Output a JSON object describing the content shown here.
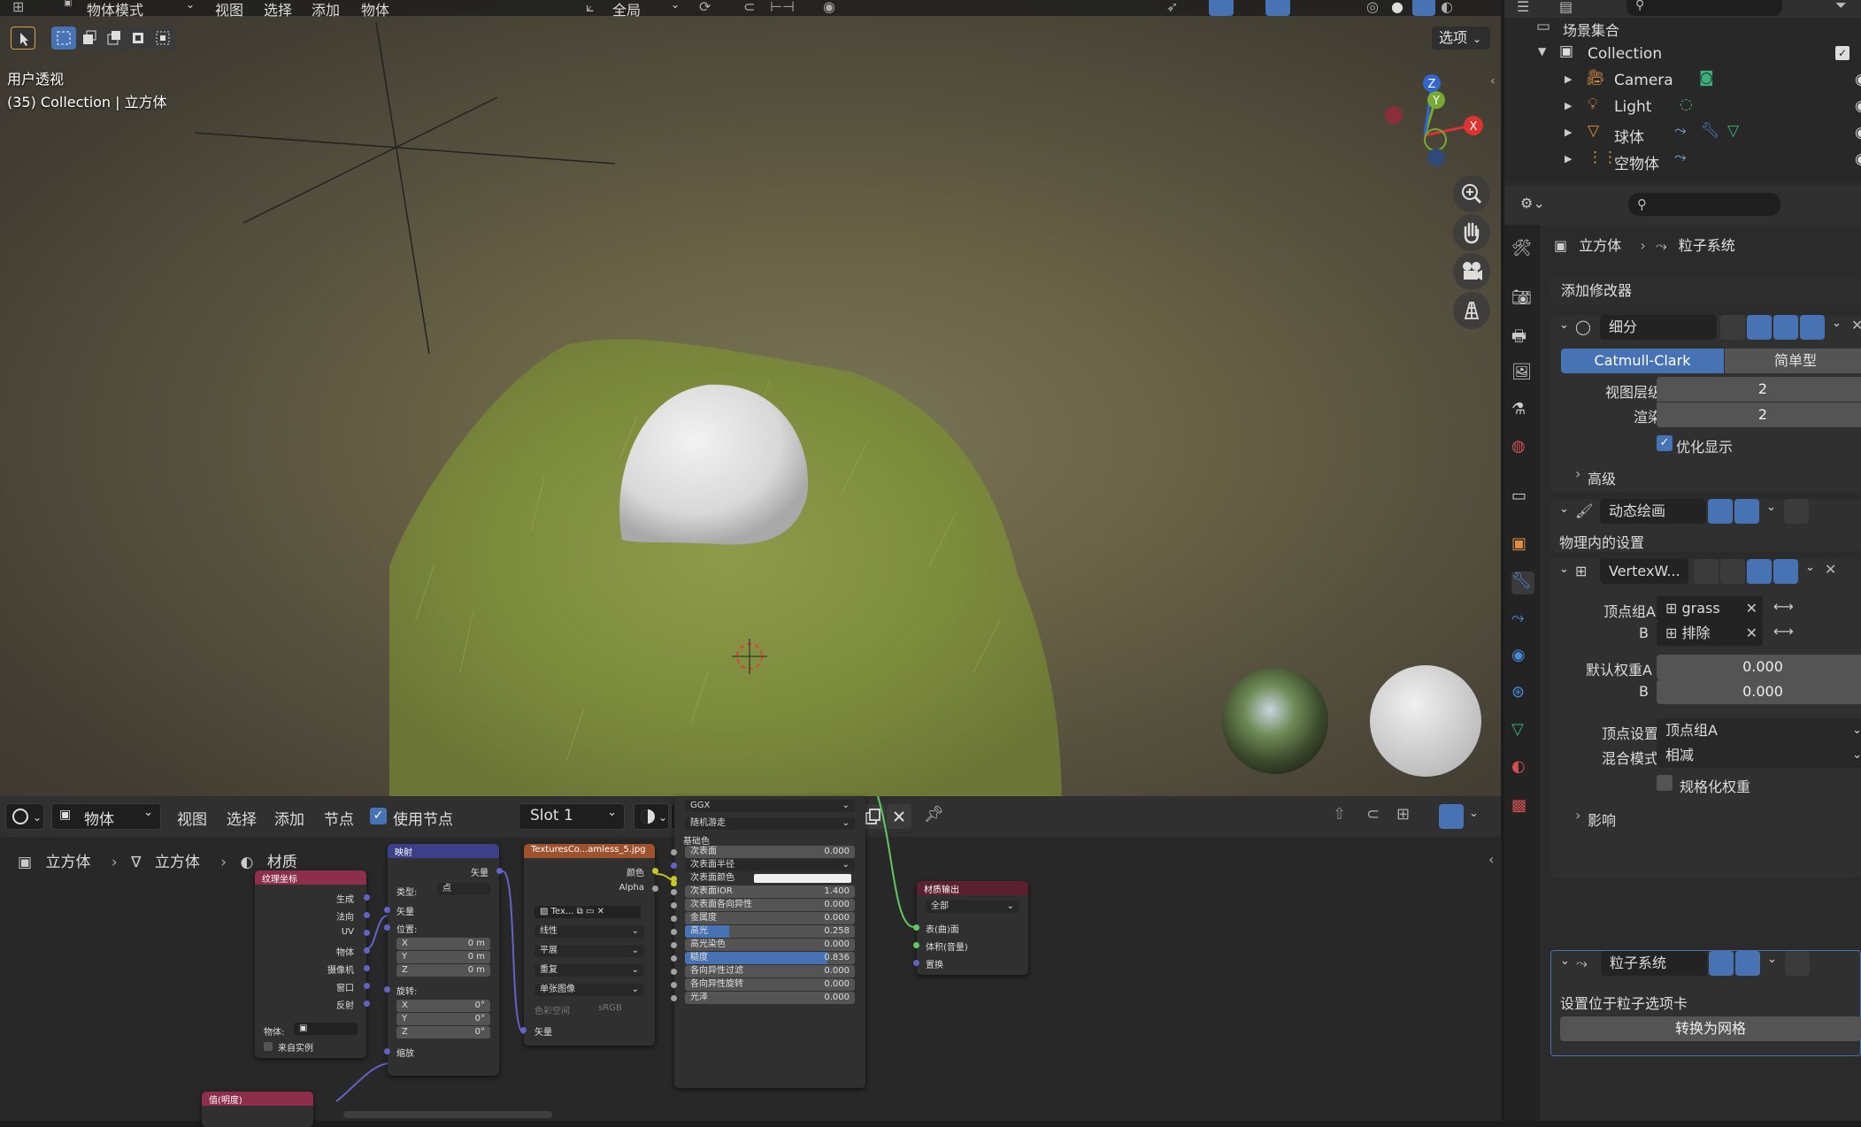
{
  "viewport": {
    "header": {
      "mode": "物体模式",
      "view": "视图",
      "select": "选择",
      "add": "添加",
      "object": "物体",
      "transform": "全局",
      "options": "选项"
    },
    "overlay_title": "用户透视",
    "overlay_sub": "(35) Collection | 立方体",
    "gizmo": {
      "x": "X",
      "y": "Y",
      "z": "Z"
    }
  },
  "node_editor": {
    "header": {
      "editor": "物体",
      "view": "视图",
      "select": "选择",
      "add": "添加",
      "node": "节点",
      "use_nodes": "使用节点",
      "slot": "Slot 1",
      "material": "材质"
    },
    "breadcrumb": [
      "立方体",
      "立方体",
      "材质"
    ],
    "nodes": {
      "texcoord": {
        "title": "纹理坐标",
        "outputs": [
          "生成",
          "法向",
          "UV",
          "物体",
          "摄像机",
          "窗口",
          "反射"
        ],
        "object_label": "物体:",
        "from_instancer": "来自实例"
      },
      "mapping": {
        "title": "映射",
        "output": "矢量",
        "type_label": "类型:",
        "type_value": "点",
        "input_vector": "矢量",
        "loc_label": "位置:",
        "loc": [
          "X",
          "0 m",
          "Y",
          "0 m",
          "Z",
          "0 m"
        ],
        "rot_label": "旋转:",
        "rot": [
          "X",
          "0°",
          "Y",
          "0°",
          "Z",
          "0°"
        ],
        "scale": "缩放"
      },
      "image": {
        "title": "TexturesCo...amless_5.jpg",
        "out_color": "颜色",
        "out_alpha": "Alpha",
        "img_name": "Tex...",
        "interp": "线性",
        "proj": "平展",
        "ext": "重复",
        "source": "单张图像",
        "colorspace_label": "色彩空间",
        "colorspace": "sRGB",
        "in_vector": "矢量"
      },
      "bsdf": {
        "dist": "GGX",
        "ss": "随机游走",
        "base_color": "基础色",
        "rows": [
          {
            "label": "次表面",
            "value": "0.000"
          },
          {
            "label": "次表面半径",
            "value": ""
          },
          {
            "label": "次表面颜色",
            "value": ""
          },
          {
            "label": "次表面IOR",
            "value": "1.400"
          },
          {
            "label": "次表面各向异性",
            "value": "0.000"
          },
          {
            "label": "金属度",
            "value": "0.000"
          },
          {
            "label": "高光",
            "value": "0.258"
          },
          {
            "label": "高光染色",
            "value": "0.000"
          },
          {
            "label": "糙度",
            "value": "0.836"
          },
          {
            "label": "各向异性过滤",
            "value": "0.000"
          },
          {
            "label": "各向异性旋转",
            "value": "0.000"
          },
          {
            "label": "光泽",
            "value": "0.000"
          }
        ],
        "specular_fill": 0.258,
        "roughness_fill": 0.836
      },
      "output": {
        "title": "材质输出",
        "target": "全部",
        "rows": [
          "表(曲)面",
          "体积(音量)",
          "置换"
        ]
      },
      "value": {
        "title": "值(明度)"
      }
    }
  },
  "outliner": {
    "scene_collection": "场景集合",
    "collection": "Collection",
    "items": [
      "Camera",
      "Light",
      "球体",
      "空物体"
    ]
  },
  "properties": {
    "breadcrumb": [
      "立方体",
      "粒子系统"
    ],
    "add_modifier": "添加修改器",
    "subsurf": {
      "name": "细分",
      "catmull": "Catmull-Clark",
      "simple": "简单型",
      "levels_label": "视图层级",
      "levels": "2",
      "render_label": "渲染",
      "render": "2",
      "optimal": "优化显示",
      "advanced": "高级"
    },
    "dynpaint": {
      "name": "动态绘画",
      "note": "物理内的设置"
    },
    "vertexweight": {
      "name": "VertexW...",
      "group_a_label": "顶点组A",
      "group_a": "grass",
      "group_b_label": "B",
      "group_b": "排除",
      "default_a_label": "默认权重A",
      "default_a": "0.000",
      "default_b_label": "B",
      "default_b": "0.000",
      "vertex_set_label": "顶点设置",
      "vertex_set": "顶点组A",
      "mix_mode_label": "混合模式",
      "mix_mode": "相减",
      "normalize": "规格化权重",
      "influence": "影响"
    },
    "particles": {
      "name": "粒子系统",
      "note": "设置位于粒子选项卡",
      "convert": "转换为网格"
    }
  },
  "colors": {
    "accent": "#4772b3",
    "grass": "#7a8a3a",
    "node_texcoord": "#8d2f4a",
    "node_mapping": "#3c3f8a",
    "node_image": "#a0522d",
    "node_output": "#5a2030"
  }
}
